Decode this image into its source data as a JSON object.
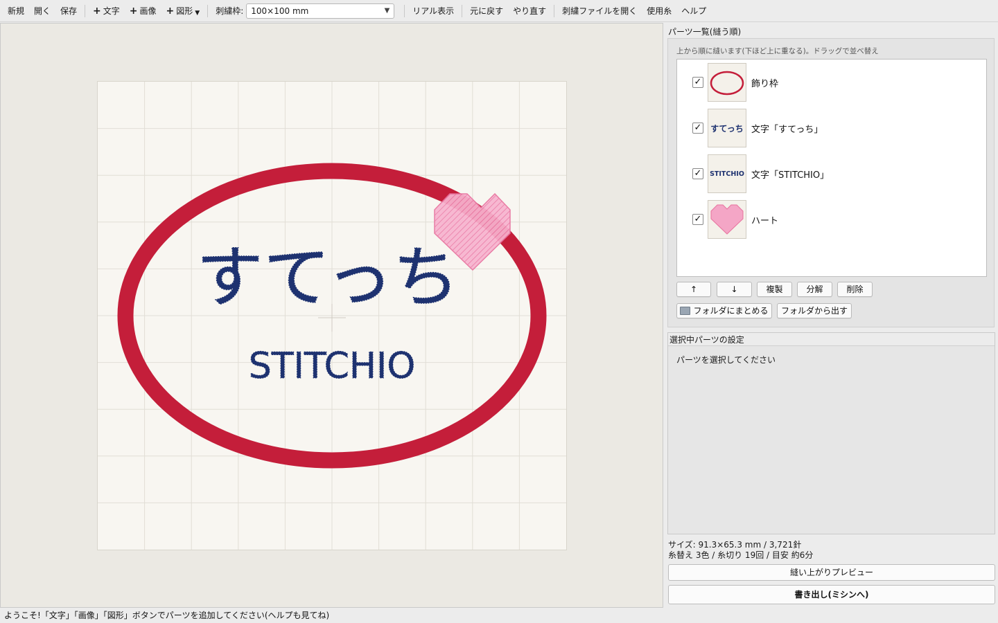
{
  "toolbar": {
    "new": "新規",
    "open": "開く",
    "save": "保存",
    "add_text": "文字",
    "add_image": "画像",
    "add_shape": "図形",
    "hoop_label": "刺繍枠:",
    "hoop_value": "100×100 mm",
    "real_view": "リアル表示",
    "undo": "元に戻す",
    "redo": "やり直す",
    "open_embroidery": "刺繍ファイルを開く",
    "threads": "使用糸",
    "help": "ヘルプ"
  },
  "canvas": {
    "text_jp": "すてっち",
    "text_en": "STITCHIO",
    "colors": {
      "frame": "#c41e3a",
      "text": "#1e3270",
      "heart": "#f4a6c6",
      "heart_stitch": "#e86a9c"
    }
  },
  "parts_panel": {
    "title": "パーツ一覧(縫う順)",
    "hint": "上から順に縫います(下ほど上に重なる)。ドラッグで並べ替え",
    "items": [
      {
        "label": "飾り枠",
        "thumb": "oval-frame-icon",
        "checked": "✓"
      },
      {
        "label": "文字「すてっち」",
        "thumb_text": "すてっち",
        "checked": "✓"
      },
      {
        "label": "文字「STITCHIO」",
        "thumb_text": "STITCHIO",
        "checked": "✓"
      },
      {
        "label": "ハート",
        "thumb": "heart-icon",
        "checked": "✓"
      }
    ],
    "buttons": {
      "up": "↑",
      "down": "↓",
      "duplicate": "複製",
      "split": "分解",
      "delete": "削除",
      "group": "フォルダにまとめる",
      "ungroup": "フォルダから出す"
    }
  },
  "settings_panel": {
    "title": "選択中パーツの設定",
    "placeholder": "パーツを選択してください"
  },
  "summary": {
    "size_line": "サイズ: 91.3×65.3 mm / 3,721針",
    "stats_line": "糸替え 3色 / 糸切り 19回 / 目安 約6分"
  },
  "actions": {
    "preview": "縫い上がりプレビュー",
    "export": "書き出し(ミシンへ)"
  },
  "status": "ようこそ!「文字」「画像」「図形」ボタンでパーツを追加してください(ヘルプも見てね)"
}
